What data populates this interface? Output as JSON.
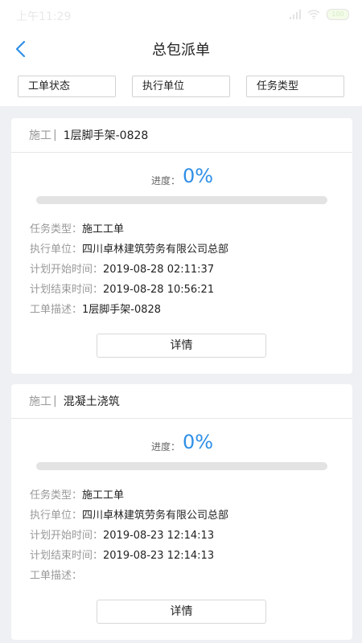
{
  "status_bar": {
    "time": "上午11:29",
    "battery": "100"
  },
  "header": {
    "title": "总包派单"
  },
  "filters": [
    {
      "label": "工单状态"
    },
    {
      "label": "执行单位"
    },
    {
      "label": "任务类型"
    }
  ],
  "cards": [
    {
      "type": "施工",
      "separator": "|",
      "name": "1层脚手架-0828",
      "progress_label": "进度：",
      "progress_value": "0%",
      "progress_fraction": 0,
      "fields": [
        {
          "key": "任务类型：",
          "value": "施工工单"
        },
        {
          "key": "执行单位：",
          "value": "四川卓林建筑劳务有限公司总部"
        },
        {
          "key": "计划开始时间：",
          "value": "2019-08-28 02:11:37"
        },
        {
          "key": "计划结束时间：",
          "value": "2019-08-28 10:56:21"
        },
        {
          "key": "工单描述：",
          "value": "1层脚手架-0828"
        }
      ],
      "button": "详情"
    },
    {
      "type": "施工",
      "separator": "|",
      "name": "混凝土浇筑",
      "progress_label": "进度：",
      "progress_value": "0%",
      "progress_fraction": 0,
      "fields": [
        {
          "key": "任务类型：",
          "value": "施工工单"
        },
        {
          "key": "执行单位：",
          "value": "四川卓林建筑劳务有限公司总部"
        },
        {
          "key": "计划开始时间：",
          "value": "2019-08-23 12:14:13"
        },
        {
          "key": "计划结束时间：",
          "value": "2019-08-23 12:14:13"
        },
        {
          "key": "工单描述：",
          "value": ""
        }
      ],
      "button": "详情"
    }
  ],
  "colors": {
    "accent": "#2f8fe6",
    "background": "#eff0f3"
  }
}
